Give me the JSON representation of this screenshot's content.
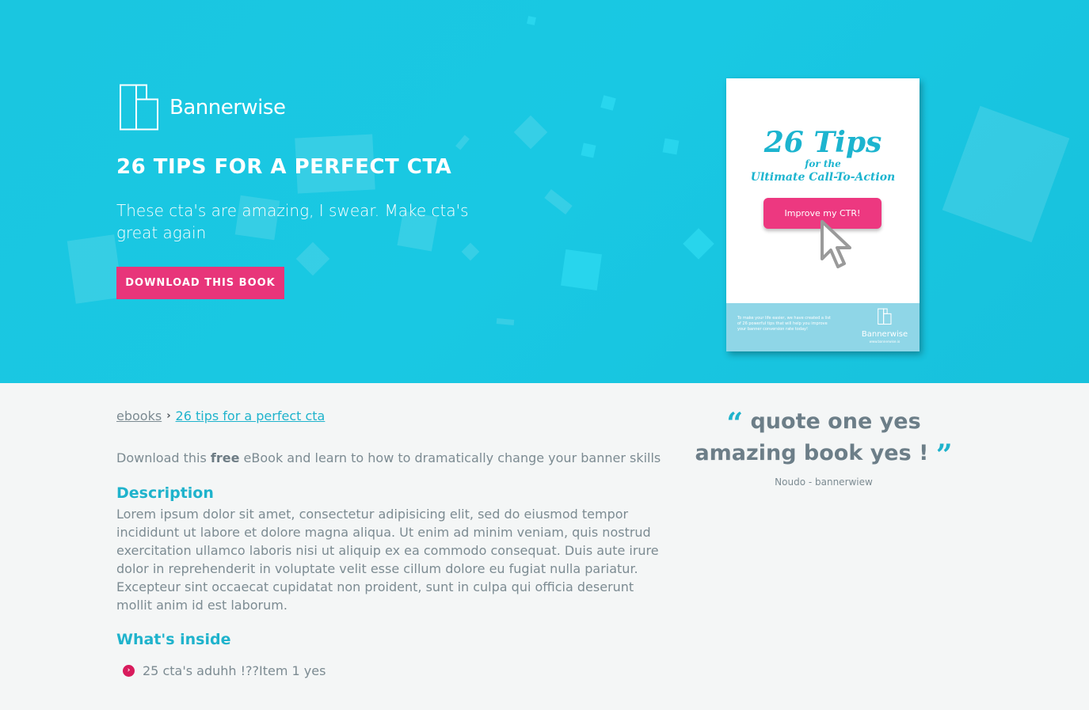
{
  "hero": {
    "brand": "Bannerwise",
    "title": "26 TIPS FOR A PERFECT CTA",
    "subtitle": "These cta's are amazing, I swear. Make cta's great again",
    "download_label": "DOWNLOAD THIS BOOK",
    "colors": {
      "background": "#19c8e3",
      "button": "#e8357a"
    }
  },
  "book_cover": {
    "title": "26 Tips",
    "subtitle_line1": "for the",
    "subtitle_line2": "Ultimate Call-To-Action",
    "cta_label": "Improve my CTR!",
    "footer_text": "To make your life easier, we have created a list of 26 powerful tips that will help you improve your banner conversion rate today!",
    "footer_brand": "Bannerwise",
    "footer_url": "www.bannerwise.io"
  },
  "breadcrumb": {
    "parent": "ebooks",
    "current": "26 tips for a perfect cta",
    "separator_icon": "chevron-right-icon"
  },
  "intro": {
    "before": "Download this ",
    "bold": "free",
    "after": " eBook and learn to how to dramatically change your banner skills"
  },
  "description": {
    "heading": "Description",
    "body": "Lorem ipsum dolor sit amet, consectetur adipisicing elit, sed do eiusmod tempor incididunt ut labore et dolore magna aliqua. Ut enim ad minim veniam, quis nostrud exercitation ullamco laboris nisi ut aliquip ex ea commodo consequat. Duis aute irure dolor in reprehenderit in voluptate velit esse cillum dolore eu fugiat nulla pariatur. Excepteur sint occaecat cupidatat non proident, sunt in culpa qui officia deserunt mollit anim id est laborum."
  },
  "whats_inside": {
    "heading": "What's inside",
    "items": [
      "25 cta's aduhh !??Item 1 yes"
    ],
    "bullet_icon": "chevron-circle-right-icon",
    "bullet_color": "#d81b5c"
  },
  "quote": {
    "open_mark": "“",
    "text": "quote one yes amazing book yes !",
    "close_mark": "”",
    "author": "Noudo - bannerwiew",
    "accent": "#1fb3cc"
  }
}
